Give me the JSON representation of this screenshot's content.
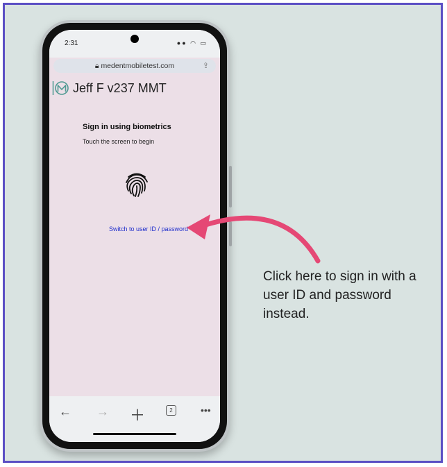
{
  "status_bar": {
    "time": "2:31",
    "icons": "●● ◠ ▭"
  },
  "browser": {
    "url": "medentmobiletest.com",
    "lock_icon": "lock-icon",
    "share_icon": "share-icon",
    "tab_count": "2"
  },
  "app": {
    "title": "Jeff F v237 MMT",
    "logo_letter": "M"
  },
  "signin": {
    "title": "Sign in using biometrics",
    "subtitle": "Touch the screen to begin",
    "switch_link": "Switch to user ID / password"
  },
  "annotation": {
    "text": "Click here to sign in with a user ID and password instead."
  },
  "colors": {
    "frame_border": "#5b4fc4",
    "background": "#d9e3e1",
    "arrow": "#e54875",
    "link": "#1f2ecc"
  }
}
